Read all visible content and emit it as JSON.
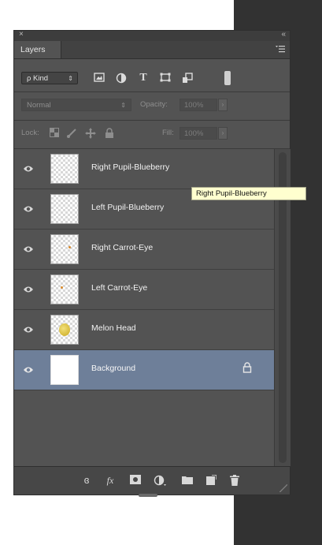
{
  "panel": {
    "close_glyph": "×",
    "collapse_glyph": "«",
    "tab_label": "Layers",
    "tab_menu_icon": "panel-menu-icon"
  },
  "filter": {
    "kind_label": "Kind",
    "kind_search_glyph": "ρ",
    "icons": [
      "pixel-filter-icon",
      "adjustment-filter-icon",
      "type-filter-icon",
      "shape-filter-icon",
      "smart-object-filter-icon",
      "filter-toggle-icon"
    ]
  },
  "blend": {
    "mode": "Normal",
    "opacity_label": "Opacity:",
    "opacity_value": "100%"
  },
  "lock": {
    "label": "Lock:",
    "fill_label": "Fill:",
    "fill_value": "100%",
    "icons": [
      "lock-transparent-pixels-icon",
      "lock-image-pixels-icon",
      "lock-position-icon",
      "lock-all-icon"
    ]
  },
  "layers": [
    {
      "name": "Right Pupil-Blueberry",
      "thumb": "transparent",
      "selected": false
    },
    {
      "name": "Left Pupil-Blueberry",
      "thumb": "transparent",
      "selected": false
    },
    {
      "name": "Right Carrot-Eye",
      "thumb": "transparent-dot",
      "selected": false
    },
    {
      "name": "Left Carrot-Eye",
      "thumb": "transparent-dot",
      "selected": false
    },
    {
      "name": "Melon Head",
      "thumb": "melon",
      "selected": false
    },
    {
      "name": "Background",
      "thumb": "white",
      "selected": true,
      "locked": true
    }
  ],
  "tooltip": "Right Pupil-Blueberry",
  "footer": {
    "link_glyph": "ɞ",
    "fx_label": "fx",
    "icons": [
      "link-layers-icon",
      "layer-style-icon",
      "layer-mask-icon",
      "adjustment-layer-icon",
      "new-group-icon",
      "new-layer-icon",
      "delete-layer-icon"
    ]
  },
  "colors": {
    "panel_bg": "#535353",
    "selected_row": "#6e7f99",
    "tooltip_bg": "#ffffcf"
  }
}
